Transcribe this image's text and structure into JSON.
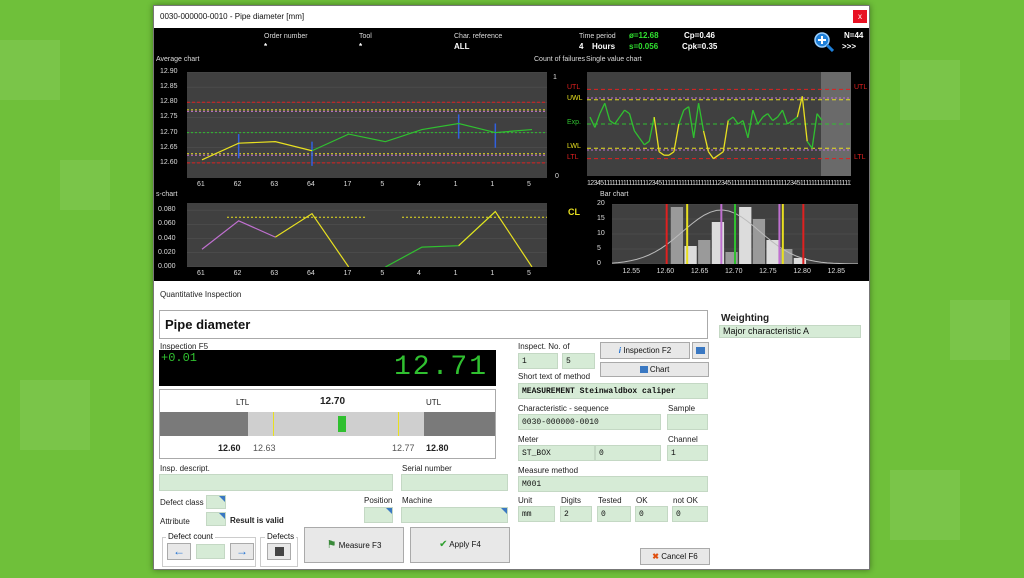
{
  "window": {
    "title": "0030-000000-0010 - Pipe diameter [mm]",
    "close": "x"
  },
  "header": {
    "order_label": "Order number",
    "order_value": "*",
    "tool_label": "Tool",
    "tool_value": "*",
    "char_ref_label": "Char. reference",
    "char_ref_value": "ALL",
    "time_label": "Time period",
    "time_value": "4",
    "time_unit": "Hours",
    "mean": "ø=12.68",
    "sigma": "s=0.056",
    "cp": "Cp=0.46",
    "cpk": "Cpk=0.35",
    "n": "N=44",
    "more": ">>>"
  },
  "avg_chart": {
    "title": "Average chart",
    "right_title": "Count of failures",
    "yticks": [
      "12.90",
      "12.85",
      "12.80",
      "12.75",
      "12.70",
      "12.65",
      "12.60"
    ],
    "right_ticks": [
      "1",
      "0"
    ],
    "x": [
      "61",
      "62",
      "63",
      "64",
      "17",
      "5",
      "4",
      "1",
      "1",
      "5"
    ],
    "values": [
      12.61,
      12.665,
      12.67,
      12.64,
      12.695,
      12.67,
      12.71,
      12.73,
      12.7,
      12.71
    ],
    "ylim": [
      12.55,
      12.9
    ]
  },
  "s_chart": {
    "title": "s-chart",
    "yticks": [
      "0.080",
      "0.060",
      "0.040",
      "0.020",
      "0.000"
    ],
    "x": [
      "61",
      "62",
      "63",
      "64",
      "17",
      "5",
      "4",
      "1",
      "1",
      "5"
    ],
    "values": [
      0.025,
      0.065,
      0.042,
      0.075,
      0.0,
      0.0,
      0.028,
      0.03,
      0.078,
      0.0
    ],
    "ylim": [
      0,
      0.09
    ]
  },
  "single_chart": {
    "title": "Single value chart",
    "labels": {
      "utl": "UTL",
      "uwl": "UWL",
      "exp": "Exp.",
      "lwl": "LWL",
      "ltl": "LTL"
    },
    "x": [
      "1",
      "2",
      "3",
      "4",
      "5",
      "1",
      "1",
      "1",
      "1",
      "1",
      "1",
      "1",
      "1",
      "1",
      "1",
      "1",
      "1",
      "1",
      "1",
      "1",
      "1",
      "2",
      "3",
      "4",
      "5",
      "1",
      "1",
      "1",
      "1",
      "1",
      "1",
      "1",
      "1",
      "1",
      "1",
      "1",
      "1",
      "1",
      "1",
      "1",
      "1",
      "1",
      "1",
      "2",
      "3",
      "4",
      "5",
      "1"
    ],
    "xticks": "1234511111111111111112345111111111111111111112345111111111111111111112345111111111111111111112345111111111111111111112345111111111111111111",
    "values": [
      12.72,
      12.69,
      12.73,
      12.76,
      12.71,
      12.7,
      12.72,
      12.74,
      12.73,
      12.68,
      12.66,
      12.64,
      12.65,
      12.72,
      12.62,
      12.61,
      12.61,
      12.62,
      12.7,
      12.74,
      12.75,
      12.66,
      12.76,
      12.68,
      12.62,
      12.6,
      12.61,
      12.62,
      12.71,
      12.72,
      12.7,
      12.71,
      12.66,
      12.74,
      12.7,
      12.72,
      12.73,
      12.71,
      12.72,
      12.74,
      12.7,
      12.71,
      12.72,
      12.78,
      12.65,
      12.63,
      12.73,
      12.71
    ],
    "ylim": [
      12.55,
      12.85
    ]
  },
  "bar_chart": {
    "title": "Bar chart",
    "yticks": [
      "20",
      "15",
      "10",
      "5",
      "0"
    ],
    "xticks": [
      "12.55",
      "12.60",
      "12.65",
      "12.70",
      "12.75",
      "12.80",
      "12.85"
    ],
    "bins": [
      12.615,
      12.635,
      12.655,
      12.675,
      12.695,
      12.715,
      12.735,
      12.755,
      12.775,
      12.795
    ],
    "values": [
      19,
      6,
      8,
      14,
      4,
      19,
      15,
      8,
      5,
      2
    ],
    "ylim": [
      0,
      20
    ]
  },
  "cl_label": "CL",
  "inspection": {
    "section_title": "Quantitative Inspection",
    "char_name": "Pipe diameter",
    "inspection_label": "Inspection  F5",
    "deviation": "+0.01",
    "value": "12.71",
    "ltl_label": "LTL",
    "utl_label": "UTL",
    "nominal": "12.70",
    "ltl_value": "12.60",
    "lwl_value": "12.63",
    "uwl_value": "12.77",
    "utl_value": "12.80",
    "gauge_position": 0.54,
    "insp_descript_label": "Insp. descript.",
    "dash": "-",
    "serial_label": "Serial number",
    "defect_class_label": "Defect class",
    "position_label": "Position",
    "machine_label": "Machine",
    "attribute_label": "Attribute",
    "result_valid": "Result is valid",
    "defect_count_label": "Defect count",
    "defects_label": "Defects",
    "measure_btn": "Measure  F3",
    "apply_btn": "Apply  F4"
  },
  "details": {
    "inspect_no_label": "Inspect. No. of",
    "inspect_no": "1",
    "inspect_of": "5",
    "inspection_btn": "Inspection  F2",
    "chart_btn": "Chart",
    "short_text_label": "Short text of method",
    "short_text": "MEASUREMENT Steinwaldbox caliper",
    "char_seq_label": "Characteristic - sequence",
    "char_seq": "0030-000000-0010",
    "sample_label": "Sample",
    "meter_label": "Meter",
    "meter": "ST_BOX",
    "meter_val": "0",
    "channel_label": "Channel",
    "channel": "1",
    "measure_method_label": "Measure method",
    "measure_method": "M001",
    "unit_label": "Unit",
    "unit": "mm",
    "digits_label": "Digits",
    "digits": "2",
    "tested_label": "Tested",
    "tested": "0",
    "ok_label": "OK",
    "ok": "0",
    "notok_label": "not OK",
    "notok": "0",
    "cancel_btn": "Cancel  F6"
  },
  "weighting": {
    "label": "Weighting",
    "value": "Major characteristic A"
  },
  "colors": {
    "limit": "#e02020",
    "warn": "#c070d0",
    "exp": "#30c030",
    "mean": "#e8e020",
    "avg": "#3060e0",
    "lcd": "#30c030"
  }
}
